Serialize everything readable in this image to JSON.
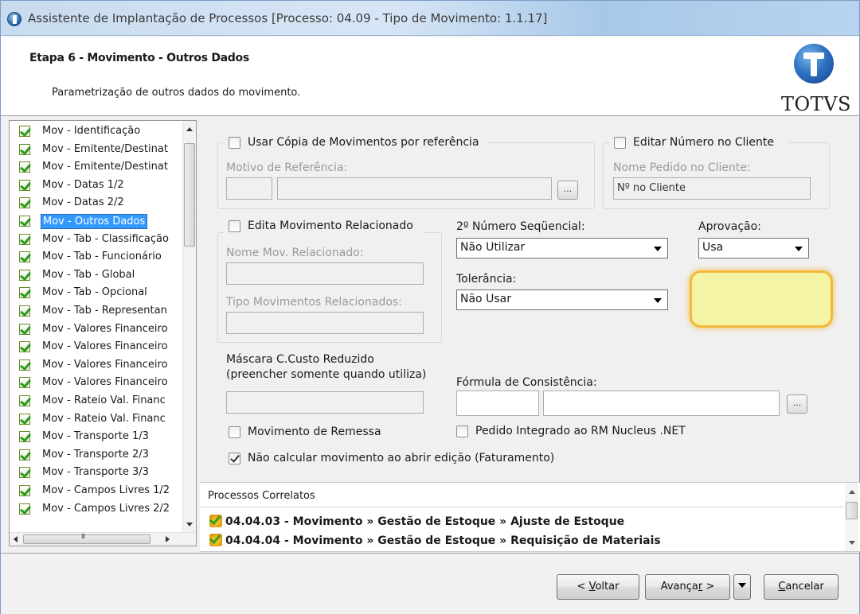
{
  "window": {
    "title": "Assistente de Implantação de Processos [Processo: 04.09 - Tipo de Movimento: 1.1.17]"
  },
  "header": {
    "step_title": "Etapa 6 - Movimento - Outros Dados",
    "subtitle": "Parametrização de outros dados do movimento.",
    "logo_text": "TOTVS"
  },
  "steps_tree": {
    "selected_index": 5,
    "items": [
      "Mov - Identificação",
      "Mov - Emitente/Destinat",
      "Mov - Emitente/Destinat",
      "Mov - Datas 1/2",
      "Mov - Datas 2/2",
      "Mov - Outros Dados",
      "Mov - Tab - Classificação",
      "Mov - Tab - Funcionário",
      "Mov - Tab - Global",
      "Mov - Tab - Opcional",
      "Mov - Tab - Representan",
      "Mov - Valores Financeiro",
      "Mov - Valores Financeiro",
      "Mov - Valores Financeiro",
      "Mov - Valores Financeiro",
      "Mov - Rateio Val. Financ",
      "Mov - Rateio Val. Financ",
      "Mov - Transporte 1/3",
      "Mov - Transporte 2/3",
      "Mov - Transporte 3/3",
      "Mov - Campos Livres 1/2",
      "Mov - Campos Livres 2/2"
    ]
  },
  "form": {
    "usar_copia": {
      "label": "Usar Cópia de Movimentos por referência",
      "checked": false
    },
    "motivo_referencia": {
      "label": "Motivo de Referência:",
      "code": "",
      "description": "",
      "dots": "..."
    },
    "editar_numero": {
      "label": "Editar Número no Cliente",
      "checked": false
    },
    "nome_pedido": {
      "label": "Nome Pedido no Cliente:",
      "value": "Nº no Cliente"
    },
    "edita_relacionado": {
      "label": "Edita Movimento Relacionado",
      "checked": false
    },
    "nome_mov_relacionado": {
      "label": "Nome Mov. Relacionado:",
      "value": ""
    },
    "tipo_mov_relacionados": {
      "label": "Tipo Movimentos Relacionados:",
      "value": ""
    },
    "segundo_numero": {
      "label": "2º Número Seqüencial:",
      "value": "Não Utilizar"
    },
    "aprovacao": {
      "label": "Aprovação:",
      "value": "Usa"
    },
    "tolerancia": {
      "label": "Tolerância:",
      "value": "Não Usar"
    },
    "mascara": {
      "label_line1": "Máscara C.Custo Reduzido",
      "label_line2": "(preencher somente quando utiliza)",
      "value": ""
    },
    "formula": {
      "label": "Fórmula de Consistência:",
      "code": "",
      "description": "",
      "dots": "..."
    },
    "mov_remessa": {
      "label": "Movimento de Remessa",
      "checked": false
    },
    "pedido_integrado": {
      "label": "Pedido Integrado ao RM Nucleus .NET",
      "checked": false
    },
    "nao_calcular": {
      "label": "Não calcular movimento ao abrir edição (Faturamento)",
      "checked": true
    }
  },
  "correlatos": {
    "title": "Processos Correlatos",
    "items": [
      "04.04.03 - Movimento » Gestão de Estoque » Ajuste de Estoque",
      "04.04.04 - Movimento » Gestão de Estoque » Requisição de Materiais"
    ]
  },
  "footer": {
    "back_prefix": "< ",
    "back_u": "V",
    "back_rest": "oltar",
    "next_pre": "Avança",
    "next_u": "r",
    "next_rest": " >",
    "cancel_u": "C",
    "cancel_rest": "ancelar"
  }
}
